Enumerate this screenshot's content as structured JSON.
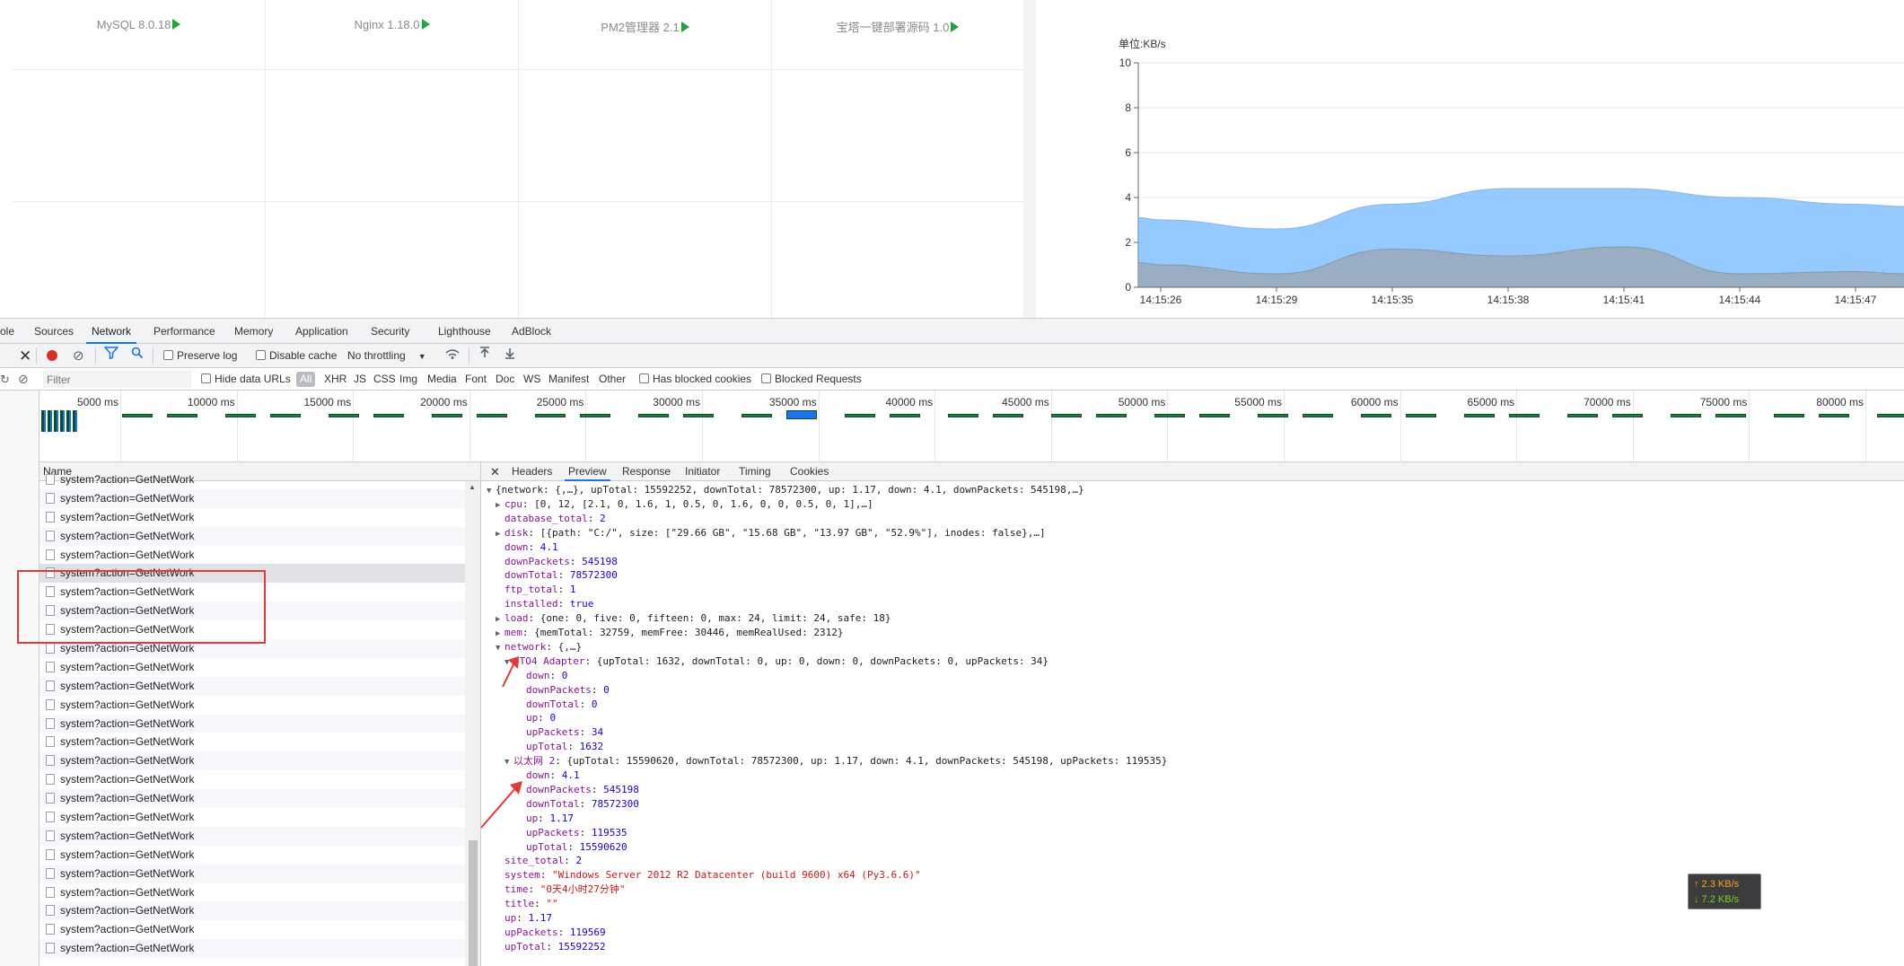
{
  "software": {
    "items": [
      {
        "name": "MySQL 8.0.18"
      },
      {
        "name": "Nginx 1.18.0"
      },
      {
        "name": "PM2管理器 2.1"
      },
      {
        "name": "宝塔一键部署源码 1.0"
      }
    ]
  },
  "chart_data": {
    "type": "area",
    "title": "",
    "ylabel": "单位:KB/s",
    "xlabel": "",
    "ylim": [
      0,
      10
    ],
    "yticks": [
      "0",
      "2",
      "4",
      "6",
      "8",
      "10"
    ],
    "x": [
      "14:15:26",
      "14:15:29",
      "14:15:35",
      "14:15:38",
      "14:15:41",
      "14:15:44",
      "14:15:47"
    ],
    "series": [
      {
        "name": "",
        "color": "#70b8ff",
        "values": [
          3.0,
          2.6,
          3.7,
          4.4,
          4.4,
          4.0,
          3.7
        ]
      },
      {
        "name": "",
        "color": "#9aa9b8",
        "values": [
          1.0,
          0.6,
          1.7,
          1.4,
          1.8,
          0.6,
          0.7
        ]
      }
    ],
    "grid": true
  },
  "devtools": {
    "tabs": [
      "ole",
      "Sources",
      "Network",
      "Performance",
      "Memory",
      "Application",
      "Security",
      "Lighthouse",
      "AdBlock"
    ],
    "active_tab": "Network",
    "toolbar": {
      "preserve_log": "Preserve log",
      "disable_cache": "Disable cache",
      "throttling": "No throttling"
    },
    "filter": {
      "placeholder": "Filter",
      "hide_data_urls": "Hide data URLs",
      "all": "All",
      "types": [
        "XHR",
        "JS",
        "CSS",
        "Img",
        "Media",
        "Font",
        "Doc",
        "WS",
        "Manifest",
        "Other"
      ],
      "has_blocked_cookies": "Has blocked cookies",
      "blocked_requests": "Blocked Requests"
    },
    "overview_ticks": [
      "5000 ms",
      "10000 ms",
      "15000 ms",
      "20000 ms",
      "25000 ms",
      "30000 ms",
      "35000 ms",
      "40000 ms",
      "45000 ms",
      "50000 ms",
      "55000 ms",
      "60000 ms",
      "65000 ms",
      "70000 ms",
      "75000 ms",
      "80000 ms"
    ],
    "request_list": {
      "header": "Name",
      "rows": [
        "system?action=GetNetWork",
        "system?action=GetNetWork",
        "system?action=GetNetWork",
        "system?action=GetNetWork",
        "system?action=GetNetWork",
        "system?action=GetNetWork",
        "system?action=GetNetWork",
        "system?action=GetNetWork",
        "system?action=GetNetWork",
        "system?action=GetNetWork",
        "system?action=GetNetWork",
        "system?action=GetNetWork",
        "system?action=GetNetWork",
        "system?action=GetNetWork",
        "system?action=GetNetWork",
        "system?action=GetNetWork",
        "system?action=GetNetWork",
        "system?action=GetNetWork",
        "system?action=GetNetWork",
        "system?action=GetNetWork",
        "system?action=GetNetWork",
        "system?action=GetNetWork",
        "system?action=GetNetWork",
        "system?action=GetNetWork",
        "system?action=GetNetWork",
        "system?action=GetNetWork"
      ]
    },
    "detail_tabs": [
      "Headers",
      "Preview",
      "Response",
      "Initiator",
      "Timing",
      "Cookies"
    ],
    "active_detail_tab": "Preview",
    "preview_lines": [
      {
        "indent": 0,
        "tri": "▼",
        "key": "",
        "sep": "",
        "val": "{network: {,…}, upTotal: 15592252, downTotal: 78572300, up: 1.17, down: 4.1, downPackets: 545198,…}",
        "vt": "p"
      },
      {
        "indent": 1,
        "tri": "▶",
        "key": "cpu",
        "sep": ": ",
        "val": "[0, 12, [2.1, 0, 1.6, 1, 0.5, 0, 1.6, 0, 0, 0.5, 0, 1],…]",
        "vt": "p"
      },
      {
        "indent": 1,
        "tri": "",
        "key": "database_total",
        "sep": ": ",
        "val": "2",
        "vt": "n"
      },
      {
        "indent": 1,
        "tri": "▶",
        "key": "disk",
        "sep": ": ",
        "val": "[{path: \"C:/\", size: [\"29.66 GB\", \"15.68 GB\", \"13.97 GB\", \"52.9%\"], inodes: false},…]",
        "vt": "p"
      },
      {
        "indent": 1,
        "tri": "",
        "key": "down",
        "sep": ": ",
        "val": "4.1",
        "vt": "n"
      },
      {
        "indent": 1,
        "tri": "",
        "key": "downPackets",
        "sep": ": ",
        "val": "545198",
        "vt": "n"
      },
      {
        "indent": 1,
        "tri": "",
        "key": "downTotal",
        "sep": ": ",
        "val": "78572300",
        "vt": "n"
      },
      {
        "indent": 1,
        "tri": "",
        "key": "ftp_total",
        "sep": ": ",
        "val": "1",
        "vt": "n"
      },
      {
        "indent": 1,
        "tri": "",
        "key": "installed",
        "sep": ": ",
        "val": "true",
        "vt": "n"
      },
      {
        "indent": 1,
        "tri": "▶",
        "key": "load",
        "sep": ": ",
        "val": "{one: 0, five: 0, fifteen: 0, max: 24, limit: 24, safe: 18}",
        "vt": "p"
      },
      {
        "indent": 1,
        "tri": "▶",
        "key": "mem",
        "sep": ": ",
        "val": "{memTotal: 32759, memFree: 30446, memRealUsed: 2312}",
        "vt": "p"
      },
      {
        "indent": 1,
        "tri": "▼",
        "key": "network",
        "sep": ": ",
        "val": "{,…}",
        "vt": "p"
      },
      {
        "indent": 2,
        "tri": "▼",
        "key": "6TO4 Adapter",
        "sep": ": ",
        "val": "{upTotal: 1632, downTotal: 0, up: 0, down: 0, downPackets: 0, upPackets: 34}",
        "vt": "p"
      },
      {
        "indent": 3,
        "tri": "",
        "key": "down",
        "sep": ": ",
        "val": "0",
        "vt": "n"
      },
      {
        "indent": 3,
        "tri": "",
        "key": "downPackets",
        "sep": ": ",
        "val": "0",
        "vt": "n"
      },
      {
        "indent": 3,
        "tri": "",
        "key": "downTotal",
        "sep": ": ",
        "val": "0",
        "vt": "n"
      },
      {
        "indent": 3,
        "tri": "",
        "key": "up",
        "sep": ": ",
        "val": "0",
        "vt": "n"
      },
      {
        "indent": 3,
        "tri": "",
        "key": "upPackets",
        "sep": ": ",
        "val": "34",
        "vt": "n"
      },
      {
        "indent": 3,
        "tri": "",
        "key": "upTotal",
        "sep": ": ",
        "val": "1632",
        "vt": "n"
      },
      {
        "indent": 2,
        "tri": "▼",
        "key": "以太网 2",
        "sep": ": ",
        "val": "{upTotal: 15590620, downTotal: 78572300, up: 1.17, down: 4.1, downPackets: 545198, upPackets: 119535}",
        "vt": "p"
      },
      {
        "indent": 3,
        "tri": "",
        "key": "down",
        "sep": ": ",
        "val": "4.1",
        "vt": "n"
      },
      {
        "indent": 3,
        "tri": "",
        "key": "downPackets",
        "sep": ": ",
        "val": "545198",
        "vt": "n"
      },
      {
        "indent": 3,
        "tri": "",
        "key": "downTotal",
        "sep": ": ",
        "val": "78572300",
        "vt": "n"
      },
      {
        "indent": 3,
        "tri": "",
        "key": "up",
        "sep": ": ",
        "val": "1.17",
        "vt": "n"
      },
      {
        "indent": 3,
        "tri": "",
        "key": "upPackets",
        "sep": ": ",
        "val": "119535",
        "vt": "n"
      },
      {
        "indent": 3,
        "tri": "",
        "key": "upTotal",
        "sep": ": ",
        "val": "15590620",
        "vt": "n"
      },
      {
        "indent": 1,
        "tri": "",
        "key": "site_total",
        "sep": ": ",
        "val": "2",
        "vt": "n"
      },
      {
        "indent": 1,
        "tri": "",
        "key": "system",
        "sep": ": ",
        "val": "\"Windows Server 2012 R2 Datacenter (build 9600) x64 (Py3.6.6)\"",
        "vt": "s"
      },
      {
        "indent": 1,
        "tri": "",
        "key": "time",
        "sep": ": ",
        "val": "\"0天4小时27分钟\"",
        "vt": "s"
      },
      {
        "indent": 1,
        "tri": "",
        "key": "title",
        "sep": ": ",
        "val": "\"\"",
        "vt": "s"
      },
      {
        "indent": 1,
        "tri": "",
        "key": "up",
        "sep": ": ",
        "val": "1.17",
        "vt": "n"
      },
      {
        "indent": 1,
        "tri": "",
        "key": "upPackets",
        "sep": ": ",
        "val": "119569",
        "vt": "n"
      },
      {
        "indent": 1,
        "tri": "",
        "key": "upTotal",
        "sep": ": ",
        "val": "15592252",
        "vt": "n"
      }
    ]
  },
  "speed_widget": {
    "up": "↑ 2.3 KB/s",
    "down": "↓ 7.2 KB/s",
    "up_color": "#f5a623",
    "down_color": "#7ed321"
  }
}
